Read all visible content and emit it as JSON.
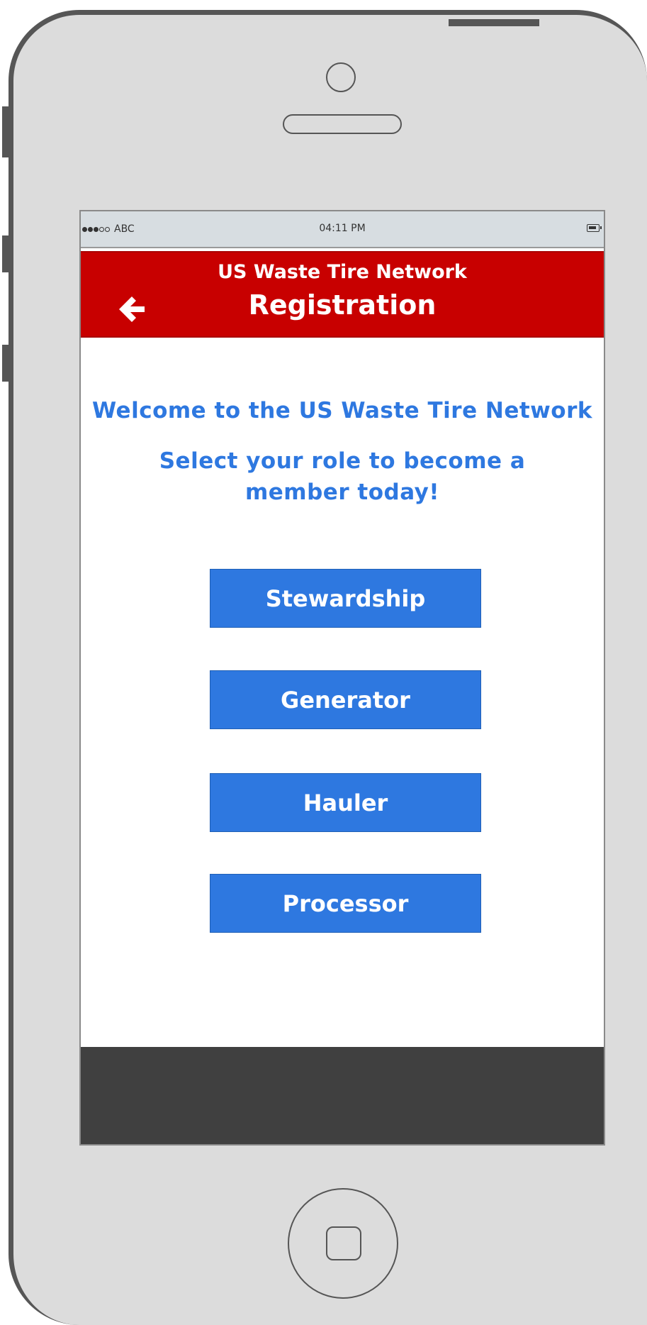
{
  "status_bar": {
    "carrier": "ABC",
    "time": "04:11 PM",
    "signal_icon": "signal-dots-icon",
    "battery_icon": "battery-icon"
  },
  "header": {
    "subtitle": "US Waste Tire Network",
    "title": "Registration",
    "back_icon": "arrow-left-icon",
    "background_color": "#c80000"
  },
  "main": {
    "welcome": "Welcome to the US Waste Tire Network",
    "instructions": "Select your role to become a member today!",
    "text_color": "#2e78e0",
    "roles": [
      {
        "label": "Stewardship"
      },
      {
        "label": "Generator"
      },
      {
        "label": "Hauler"
      },
      {
        "label": "Processor"
      }
    ],
    "button_color": "#2e78e0"
  },
  "footer": {
    "color": "#404040"
  }
}
